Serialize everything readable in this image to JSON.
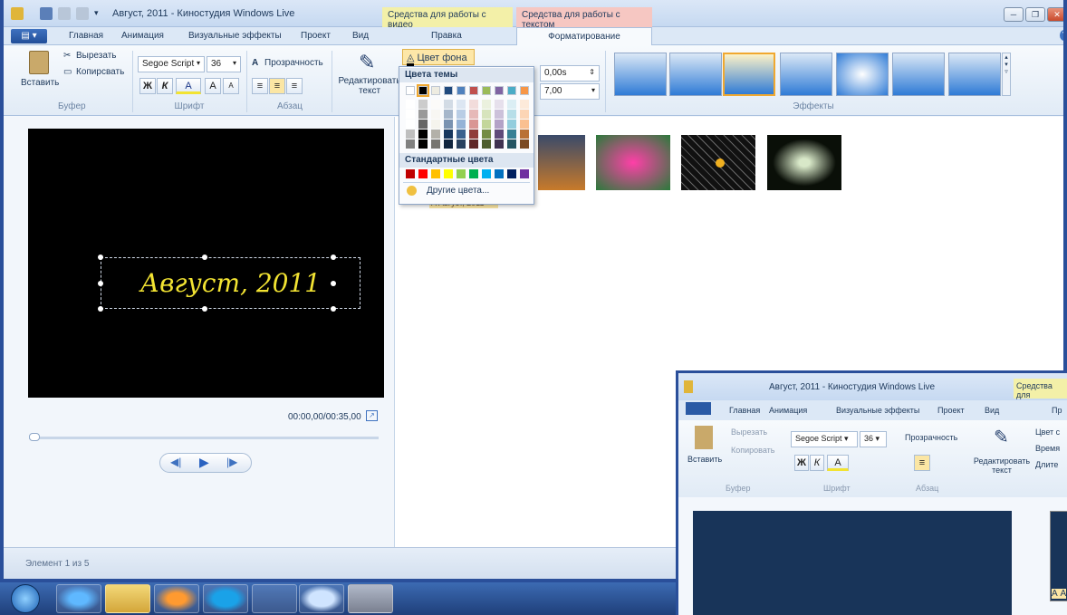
{
  "window": {
    "title": "Август, 2011 - Киностудия Windows Live",
    "context_tab_video": "Средства для работы с видео",
    "context_tab_text": "Средства для работы с текстом"
  },
  "tabs": [
    "Главная",
    "Анимация",
    "Визуальные эффекты",
    "Проект",
    "Вид",
    "Правка",
    "Форматирование"
  ],
  "ribbon": {
    "clipboard": {
      "paste": "Вставить",
      "cut": "Вырезать",
      "copy": "Копирсвать",
      "group": "Буфер"
    },
    "font": {
      "family": "Segoe Script",
      "size": "36",
      "group": "Шрифт",
      "bold": "Ж",
      "italic": "К",
      "color": "A",
      "grow": "A",
      "shrink": "A"
    },
    "paragraph": {
      "transparency": "Прозрачность",
      "group": "Абзац"
    },
    "edit_text": "Редактировать текст",
    "bg_color_button": "Цвет фона",
    "start_time": "0,00s",
    "duration": "7,00",
    "effects_group": "Эффекты"
  },
  "color_menu": {
    "theme_header": "Цвета темы",
    "standard_header": "Стандартные цвета",
    "more_colors": "Другие цвета...",
    "colors": {
      "theme": [
        "#ffffff",
        "#000000",
        "#eeece1",
        "#1f497d",
        "#4f81bd",
        "#c0504d",
        "#9bbb59",
        "#8064a2",
        "#4bacc6",
        "#f79646"
      ],
      "standard": [
        "#c00000",
        "#ff0000",
        "#ffc000",
        "#ffff00",
        "#92d050",
        "#00b050",
        "#00b0f0",
        "#0070c0",
        "#002060",
        "#7030a0"
      ]
    }
  },
  "preview": {
    "caption": "Август, 2011",
    "time": "00:00,00/00:35,00"
  },
  "storyboard": {
    "clip_caption": "A Август, 2011"
  },
  "status": {
    "item_counter": "Элемент 1 из 5"
  },
  "inset": {
    "title": "Август, 2011 - Киностудия Windows Live",
    "context_tab": "Средства для",
    "tabs": [
      "Главная",
      "Анимация",
      "Визуальные эффекты",
      "Проект",
      "Вид",
      "Пр"
    ],
    "paste": "Вставить",
    "cut": "Вырезать",
    "copy": "Копировать",
    "clipboard_group": "Буфер",
    "font_family": "Segoe Script",
    "font_size": "36",
    "font_group": "Шрифт",
    "transparency": "Прозрачность",
    "paragraph_group": "Абзац",
    "edit_text": "Редактировать текст",
    "bg_color": "Цвет с",
    "time": "Время",
    "duration": "Длите",
    "side_text": "А А"
  }
}
